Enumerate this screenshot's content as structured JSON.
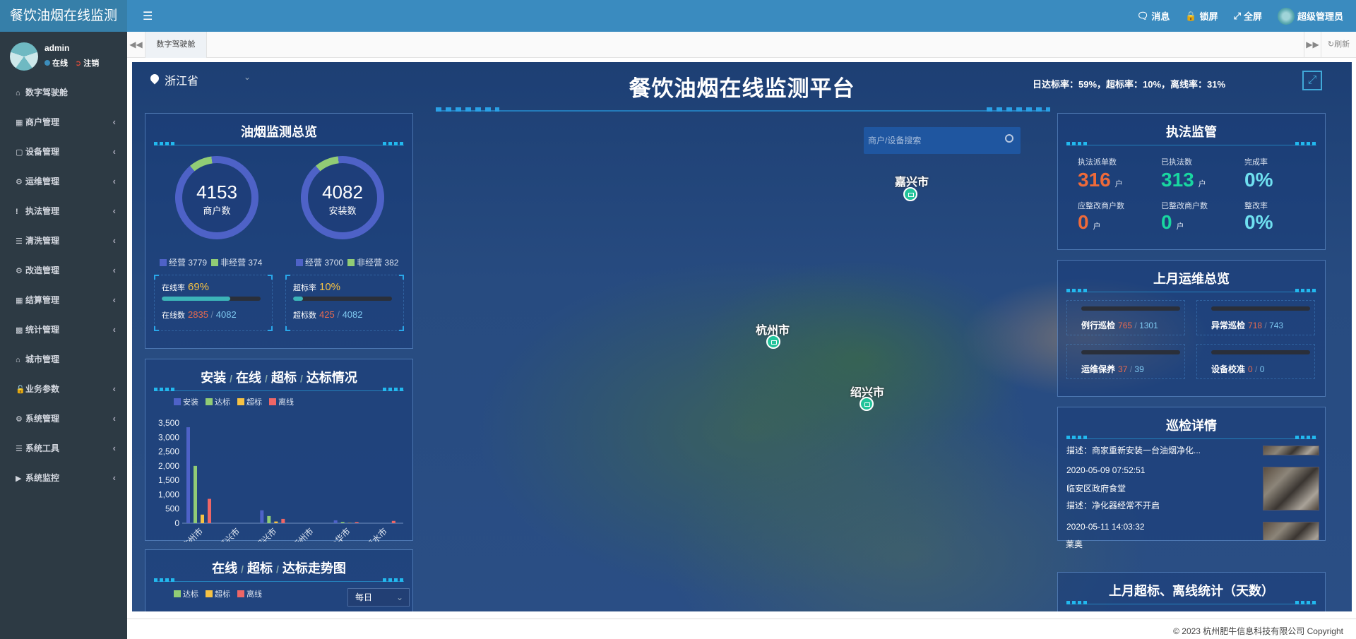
{
  "app": {
    "brand": "餐饮油烟在线监测",
    "menu_icon": "hamburger-icon"
  },
  "topbar": {
    "message": "消息",
    "lock": "锁屏",
    "fullscreen": "全屏",
    "admin": "超级管理员"
  },
  "user": {
    "name": "admin",
    "status": "在线",
    "logout": "注销"
  },
  "sidebar": {
    "items": [
      {
        "label": "数字驾驶舱",
        "icon": "home-icon",
        "has_children": false
      },
      {
        "label": "商户管理",
        "icon": "building-icon",
        "has_children": true
      },
      {
        "label": "设备管理",
        "icon": "calendar-icon",
        "has_children": true
      },
      {
        "label": "运维管理",
        "icon": "wrench-icon",
        "has_children": true
      },
      {
        "label": "执法管理",
        "icon": "exclamation-icon",
        "has_children": true
      },
      {
        "label": "清洗管理",
        "icon": "list-icon",
        "has_children": true
      },
      {
        "label": "改造管理",
        "icon": "wrench-icon",
        "has_children": true
      },
      {
        "label": "结算管理",
        "icon": "calculator-icon",
        "has_children": true
      },
      {
        "label": "统计管理",
        "icon": "bar-chart-icon",
        "has_children": true
      },
      {
        "label": "城市管理",
        "icon": "bank-icon",
        "has_children": false
      },
      {
        "label": "业务参数",
        "icon": "unlock-icon",
        "has_children": true
      },
      {
        "label": "系统管理",
        "icon": "gear-icon",
        "has_children": true
      },
      {
        "label": "系统工具",
        "icon": "list-icon",
        "has_children": true
      },
      {
        "label": "系统监控",
        "icon": "video-icon",
        "has_children": true
      }
    ]
  },
  "tabs": {
    "active": "数字驾驶舱",
    "refresh": "刷新"
  },
  "dash": {
    "title": "餐饮油烟在线监测平台",
    "province": "浙江省",
    "rates": "日达标率：59%，超标率：10%，离线率：31%",
    "search_placeholder": "商户/设备搜索",
    "cities": [
      {
        "name": "嘉兴市"
      },
      {
        "name": "杭州市"
      },
      {
        "name": "绍兴市"
      }
    ]
  },
  "overview": {
    "title": "油烟监测总览",
    "merchants": {
      "value": "4153",
      "label": "商户数",
      "legend": [
        {
          "label": "经营",
          "value": "3779"
        },
        {
          "label": "非经营",
          "value": "374"
        }
      ]
    },
    "installs": {
      "value": "4082",
      "label": "安装数",
      "legend": [
        {
          "label": "经营",
          "value": "3700"
        },
        {
          "label": "非经营",
          "value": "382"
        }
      ]
    },
    "online": {
      "rate_label": "在线率",
      "rate": "69%",
      "rate_value": 0.69,
      "count_label": "在线数",
      "count": "2835",
      "total": "4082"
    },
    "exceed": {
      "rate_label": "超标率",
      "rate": "10%",
      "rate_value": 0.1,
      "count_label": "超标数",
      "count": "425",
      "total": "4082"
    },
    "sep": "/"
  },
  "colors": {
    "install": "#4e62c7",
    "ok": "#91cc75",
    "exceed": "#f6c244",
    "offline": "#ee6666",
    "orange": "#ee6a3a",
    "green": "#19d6a0",
    "cyan": "#6fe0f0"
  },
  "chart_install": {
    "title": "安装",
    "title_sep": "/",
    "title_parts": [
      "在线",
      "超标",
      "达标情况"
    ]
  },
  "chart_data": [
    {
      "type": "bar",
      "categories": [
        "杭州市",
        "嘉兴市",
        "绍兴市",
        "衢州市",
        "金华市",
        "丽水市"
      ],
      "series": [
        {
          "name": "安装",
          "values": [
            3350,
            0,
            450,
            0,
            100,
            0
          ]
        },
        {
          "name": "达标",
          "values": [
            2000,
            0,
            250,
            0,
            40,
            0
          ]
        },
        {
          "name": "超标",
          "values": [
            300,
            0,
            60,
            0,
            10,
            0
          ]
        },
        {
          "name": "离线",
          "values": [
            850,
            0,
            150,
            0,
            40,
            80
          ]
        }
      ],
      "yticks": [
        "0",
        "500",
        "1,000",
        "1,500",
        "2,000",
        "2,500",
        "3,000",
        "3,500"
      ],
      "ylim": [
        0,
        3500
      ]
    }
  ],
  "trend": {
    "title": "在线 / 超标 / 达标走势图",
    "title_parts": [
      "在线",
      "超标",
      "达标走势图"
    ],
    "legend": [
      "达标",
      "超标",
      "离线"
    ],
    "period": "每日"
  },
  "enforcement": {
    "title": "执法监管",
    "items": [
      {
        "label": "执法派单数",
        "value": "316",
        "unit": "户"
      },
      {
        "label": "已执法数",
        "value": "313",
        "unit": "户"
      },
      {
        "label": "完成率",
        "value": "0%",
        "unit": ""
      },
      {
        "label": "应整改商户数",
        "value": "0",
        "unit": "户"
      },
      {
        "label": "已整改商户数",
        "value": "0",
        "unit": "户"
      },
      {
        "label": "整改率",
        "value": "0%",
        "unit": ""
      }
    ]
  },
  "ops": {
    "title": "上月运维总览",
    "items": [
      {
        "label": "例行巡检",
        "done": "765",
        "total": "1301"
      },
      {
        "label": "异常巡检",
        "done": "718",
        "total": "743"
      },
      {
        "label": "运维保养",
        "done": "37",
        "total": "39"
      },
      {
        "label": "设备校准",
        "done": "0",
        "total": "0"
      }
    ]
  },
  "inspection": {
    "title": "巡检详情",
    "entries": [
      {
        "desc": "描述：商家重新安装一台油烟净化..."
      },
      {
        "time": "2020-05-09 07:52:51",
        "place": "临安区政府食堂",
        "desc": "描述：净化器经常不开启"
      },
      {
        "time": "2020-05-11 14:03:32",
        "place": "莱奥"
      }
    ]
  },
  "stats": {
    "title": "上月超标、离线统计（天数）"
  },
  "footer": {
    "copyright": "© 2023 杭州肥牛信息科技有限公司 Copyright"
  }
}
